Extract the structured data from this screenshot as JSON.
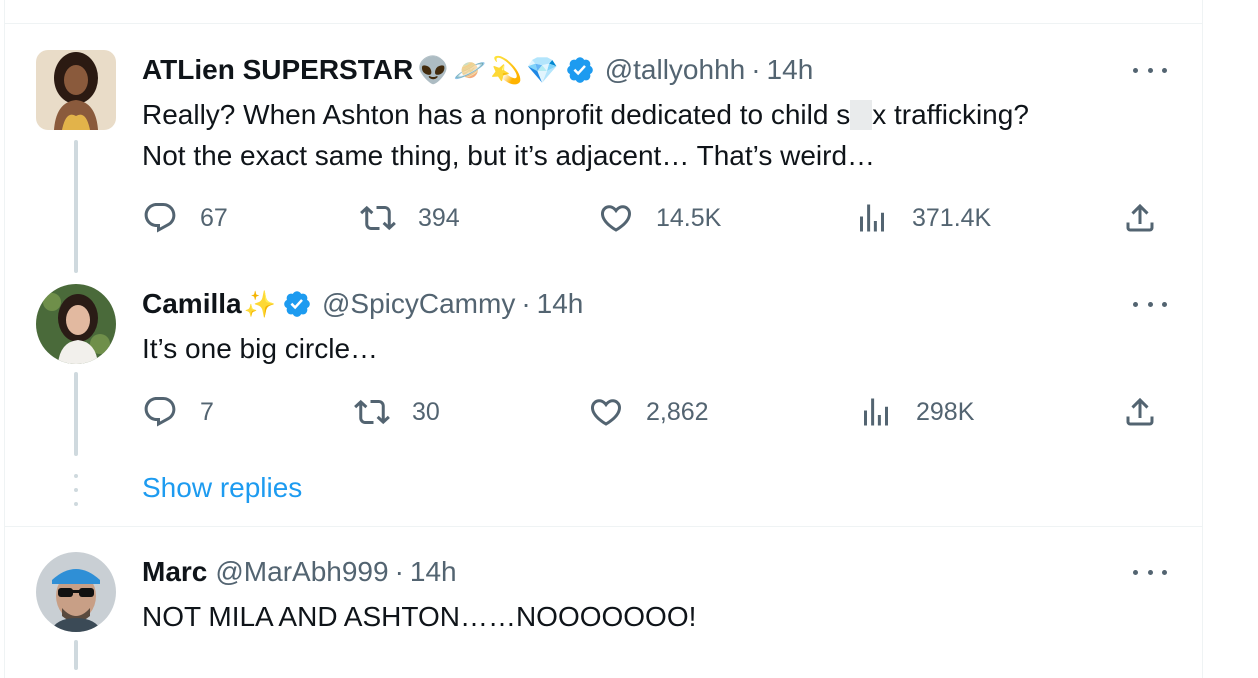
{
  "tweets": [
    {
      "display_name": "ATLien SUPERSTAR",
      "name_emojis": [
        "👽",
        "🪐",
        "💫",
        "💎"
      ],
      "verified": true,
      "handle": "@tallyohhh",
      "separator": "·",
      "time": "14h",
      "text_line1_a": "Really? When Ashton has a nonprofit dedicated to child s",
      "text_line1_b": "x trafficking?",
      "text_line2": "Not the exact same thing, but it’s adjacent… That’s weird…",
      "replies": "67",
      "retweets": "394",
      "likes": "14.5K",
      "views": "371.4K"
    },
    {
      "display_name": "Camilla",
      "name_emojis": [
        "✨"
      ],
      "verified": true,
      "handle": "@SpicyCammy",
      "separator": "·",
      "time": "14h",
      "text": "It’s one big circle…",
      "replies": "7",
      "retweets": "30",
      "likes": "2,862",
      "views": "298K"
    },
    {
      "display_name": "Marc",
      "verified": false,
      "handle": "@MarAbh999",
      "separator": "·",
      "time": "14h",
      "text": "NOT MILA AND ASHTON……NOOOOOOO!"
    }
  ],
  "show_replies_label": "Show replies",
  "icons": {
    "reply": "reply-icon",
    "retweet": "retweet-icon",
    "like": "heart-icon",
    "views": "views-icon",
    "share": "share-icon",
    "more": "more-icon",
    "verified": "verified-badge-icon"
  },
  "colors": {
    "accent": "#1d9bf0",
    "secondary_text": "#536471",
    "thread_line": "#cfd9de"
  }
}
